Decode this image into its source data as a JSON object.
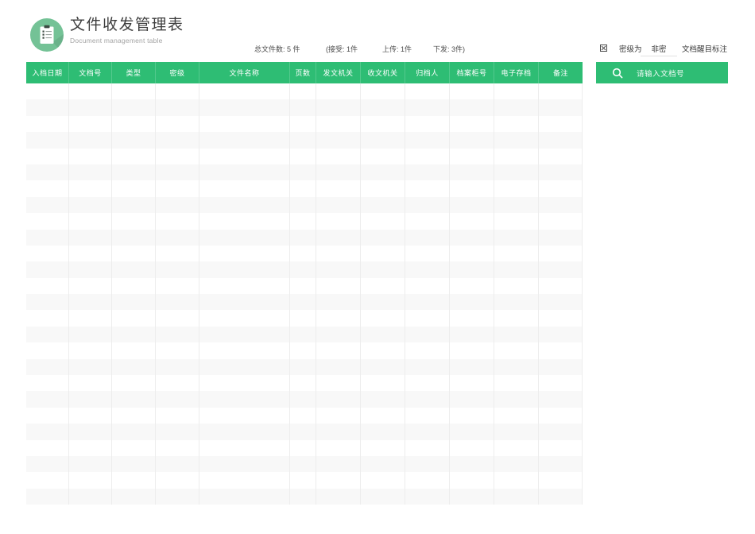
{
  "header": {
    "title": "文件收发管理表",
    "subtitle": "Document management table"
  },
  "stats": {
    "total": "总文件数: 5 件",
    "received": "(接受: 1件",
    "uploaded": "上传: 1件",
    "issued": "下发: 3件)"
  },
  "classification": {
    "checkbox_icon": "checkbox-x-icon",
    "label": "密级为",
    "value": "非密",
    "note": "文档醒目标注"
  },
  "search": {
    "icon": "search-icon",
    "placeholder": "请输入文档号"
  },
  "table": {
    "columns": [
      "入档日期",
      "文档号",
      "类型",
      "密级",
      "文件名称",
      "页数",
      "发文机关",
      "收文机关",
      "归档人",
      "档案柜号",
      "电子存档",
      "备注"
    ],
    "row_count": 26,
    "rows": []
  },
  "colors": {
    "accent_green": "#2ebd74",
    "logo_green": "#74c296",
    "zebra_row": "#f8f8f8",
    "grid_line": "#ededed"
  }
}
